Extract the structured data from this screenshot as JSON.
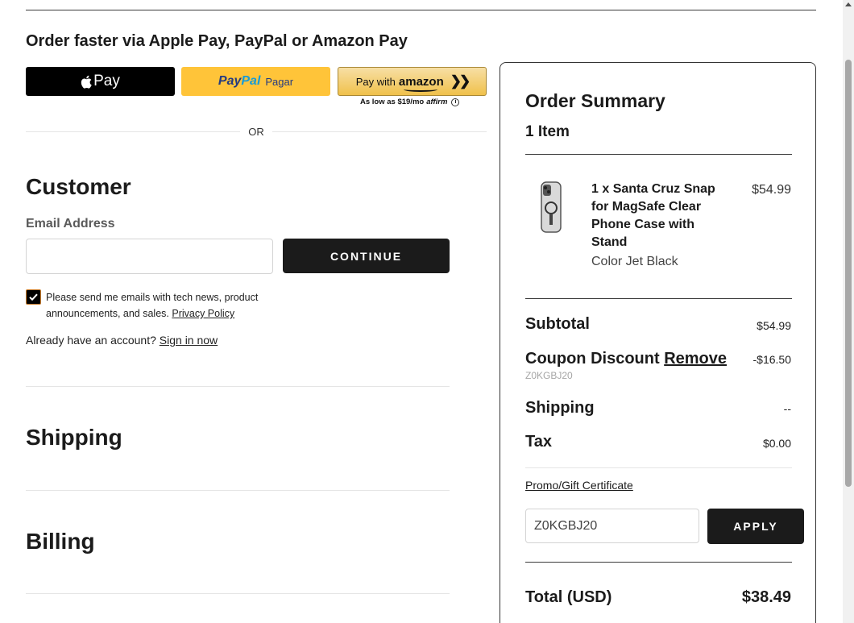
{
  "express": {
    "title": "Order faster via Apple Pay, PayPal or Amazon Pay",
    "apple_pay_label": "Pay",
    "paypal_pay": "Pay",
    "paypal_pal": "Pal",
    "paypal_pagar": "Pagar",
    "amazon_pay_with": "Pay with",
    "amazon_brand": "amazon",
    "affirm_text": "As low as $19/mo",
    "affirm_logo": "affirm",
    "or_text": "OR"
  },
  "customer": {
    "title": "Customer",
    "email_label": "Email Address",
    "email_value": "",
    "continue_label": "CONTINUE",
    "newsletter_checked": true,
    "consent_text": "Please send me emails with tech news, product announcements, and sales. ",
    "privacy_link": "Privacy Policy",
    "account_text": "Already have an account? ",
    "sign_in_link": "Sign in now"
  },
  "shipping": {
    "title": "Shipping"
  },
  "billing": {
    "title": "Billing"
  },
  "summary": {
    "title": "Order Summary",
    "item_count": "1 Item",
    "product": {
      "name": "1 x Santa Cruz Snap for MagSafe Clear Phone Case with Stand",
      "variant": "Color Jet Black",
      "price": "$54.99"
    },
    "subtotal_label": "Subtotal",
    "subtotal_value": "$54.99",
    "coupon_label": "Coupon Discount ",
    "coupon_remove": "Remove",
    "coupon_value": "-$16.50",
    "coupon_code": "Z0KGBJ20",
    "shipping_label": "Shipping",
    "shipping_value": "--",
    "tax_label": "Tax",
    "tax_value": "$0.00",
    "promo_link": "Promo/Gift Certificate",
    "promo_input_value": "Z0KGBJ20",
    "apply_label": "APPLY",
    "total_label": "Total (USD)",
    "total_value": "$38.49"
  },
  "colors": {
    "primary_button": "#1b1b1b",
    "paypal_yellow": "#ffc439",
    "amazon_gold": "#f0c14b"
  }
}
